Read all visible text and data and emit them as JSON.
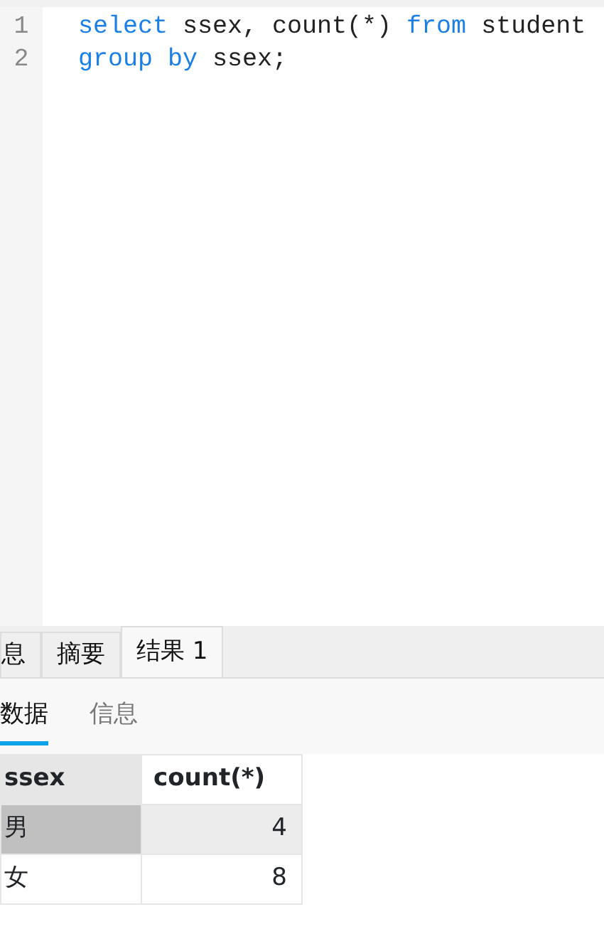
{
  "editor": {
    "lines": [
      {
        "number": "1",
        "tokens": [
          {
            "text": "select",
            "kind": "keyword"
          },
          {
            "text": " ssex, count(*) ",
            "kind": "plain"
          },
          {
            "text": "from",
            "kind": "keyword"
          },
          {
            "text": " student",
            "kind": "plain"
          }
        ]
      },
      {
        "number": "2",
        "tokens": [
          {
            "text": "group by",
            "kind": "keyword"
          },
          {
            "text": " ssex;",
            "kind": "plain"
          }
        ]
      }
    ]
  },
  "result_tabs": [
    {
      "label": "息",
      "selected": false
    },
    {
      "label": "摘要",
      "selected": false
    },
    {
      "label": "结果 1",
      "selected": true
    }
  ],
  "view_tabs": [
    {
      "label": "数据",
      "selected": true
    },
    {
      "label": "信息",
      "selected": false
    }
  ],
  "table": {
    "columns": [
      "ssex",
      "count(*)"
    ],
    "rows": [
      {
        "cells": [
          "男",
          "4"
        ],
        "selected": true
      },
      {
        "cells": [
          "女",
          "8"
        ],
        "selected": false
      }
    ]
  }
}
